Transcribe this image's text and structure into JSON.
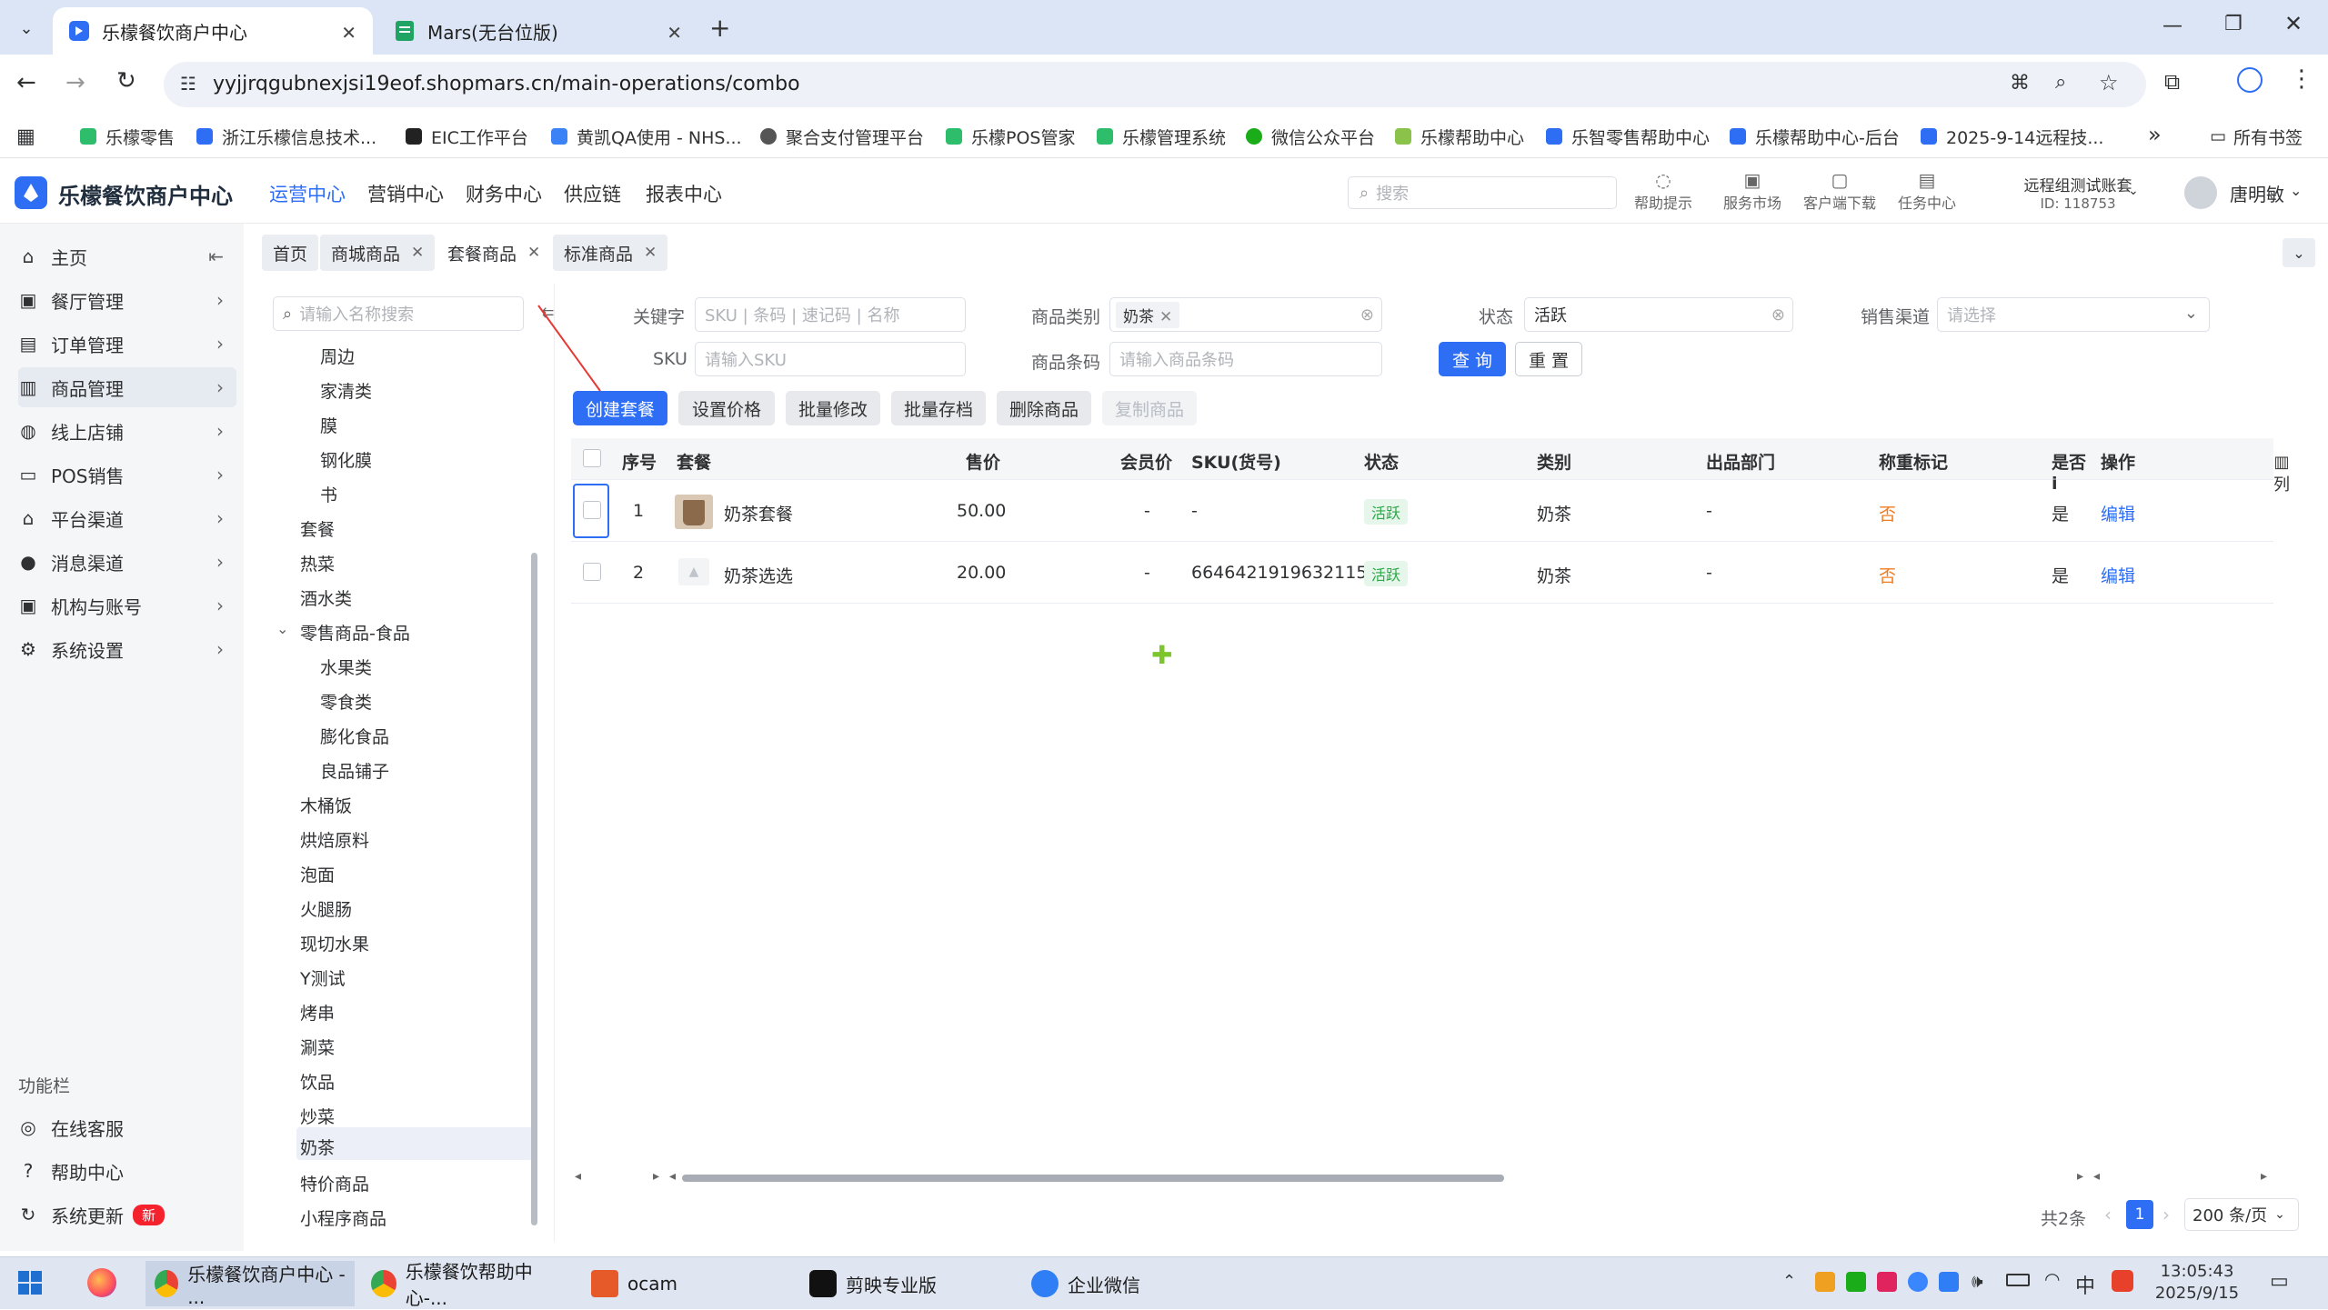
{
  "browser": {
    "tabs": [
      {
        "title": "乐檬餐饮商户中心"
      },
      {
        "title": "Mars(无台位版)"
      }
    ],
    "url": "yyjjrqgubnexjsi19eof.shopmars.cn/main-operations/combo",
    "bookmarks": [
      "乐檬零售",
      "浙江乐檬信息技术...",
      "EIC工作平台",
      "黄凯QA使用 - NHS...",
      "聚合支付管理平台",
      "乐檬POS管家",
      "乐檬管理系统",
      "微信公众平台",
      "乐檬帮助中心",
      "乐智零售帮助中心",
      "乐檬帮助中心-后台",
      "2025-9-14远程技..."
    ],
    "bookmarks_more": "»",
    "all_bookmarks": "所有书签"
  },
  "header": {
    "brand": "乐檬餐饮商户中心",
    "nav": [
      "运营中心",
      "营销中心",
      "财务中心",
      "供应链",
      "报表中心"
    ],
    "search_placeholder": "搜索",
    "icons": [
      "帮助提示",
      "服务市场",
      "客户端下载",
      "任务中心"
    ],
    "account_name": "远程组测试账套",
    "account_id": "ID: 118753",
    "user": "唐明敏"
  },
  "sidebar": {
    "items": [
      "主页",
      "餐厅管理",
      "订单管理",
      "商品管理",
      "线上店铺",
      "POS销售",
      "平台渠道",
      "消息渠道",
      "机构与账号",
      "系统设置"
    ],
    "func_title": "功能栏",
    "func_items": [
      "在线客服",
      "帮助中心",
      "系统更新"
    ],
    "new_badge": "新"
  },
  "pagetabs": [
    "首页",
    "商城商品",
    "套餐商品",
    "标准商品"
  ],
  "tree": {
    "search_placeholder": "请输入名称搜索",
    "collapse_glyph": "⇇",
    "nodes": [
      "周边",
      "家清类",
      "膜",
      "钢化膜",
      "书",
      "套餐",
      "热菜",
      "酒水类",
      "零售商品-食品",
      "水果类",
      "零食类",
      "膨化食品",
      "良品铺子",
      "木桶饭",
      "烘焙原料",
      "泡面",
      "火腿肠",
      "现切水果",
      "Y测试",
      "烤串",
      "涮菜",
      "饮品",
      "炒菜",
      "奶茶",
      "特价商品",
      "小程序商品"
    ]
  },
  "filters": {
    "keyword_label": "关键字",
    "keyword_placeholder": "SKU | 条码 | 速记码 | 名称",
    "category_label": "商品类别",
    "category_tag": "奶茶",
    "status_label": "状态",
    "status_value": "活跃",
    "channel_label": "销售渠道",
    "channel_placeholder": "请选择",
    "sku_label": "SKU",
    "sku_placeholder": "请输入SKU",
    "barcode_label": "商品条码",
    "barcode_placeholder": "请输入商品条码",
    "query_btn": "查 询",
    "reset_btn": "重 置"
  },
  "actions": [
    "创建套餐",
    "设置价格",
    "批量修改",
    "批量存档",
    "删除商品",
    "复制商品"
  ],
  "table": {
    "columns": [
      "序号",
      "套餐",
      "售价",
      "会员价",
      "SKU(货号)",
      "状态",
      "类别",
      "出品部门",
      "称重标记",
      "是否i",
      "操作"
    ],
    "column_setting": "列",
    "rows": [
      {
        "idx": "1",
        "name": "奶茶套餐",
        "price": "50.00",
        "member": "-",
        "sku": "-",
        "status": "活跃",
        "category": "奶茶",
        "dept": "-",
        "weigh": "否",
        "flag": "是",
        "op": "编辑"
      },
      {
        "idx": "2",
        "name": "奶茶选选",
        "price": "20.00",
        "member": "-",
        "sku": "6646421919632115",
        "status": "活跃",
        "category": "奶茶",
        "dept": "-",
        "weigh": "否",
        "flag": "是",
        "op": "编辑"
      }
    ]
  },
  "pagination": {
    "total": "共2条",
    "current": "1",
    "size": "200 条/页"
  },
  "taskbar": {
    "apps": [
      "乐檬餐饮商户中心 - ...",
      "乐檬餐饮帮助中心-...",
      "ocam",
      "剪映专业版",
      "企业微信"
    ],
    "ime": "中",
    "time": "13:05:43",
    "date": "2025/9/15"
  },
  "colors": {
    "primary": "#2d6ef5",
    "active_tag": "#2da74a",
    "warn": "#f07c1f"
  }
}
